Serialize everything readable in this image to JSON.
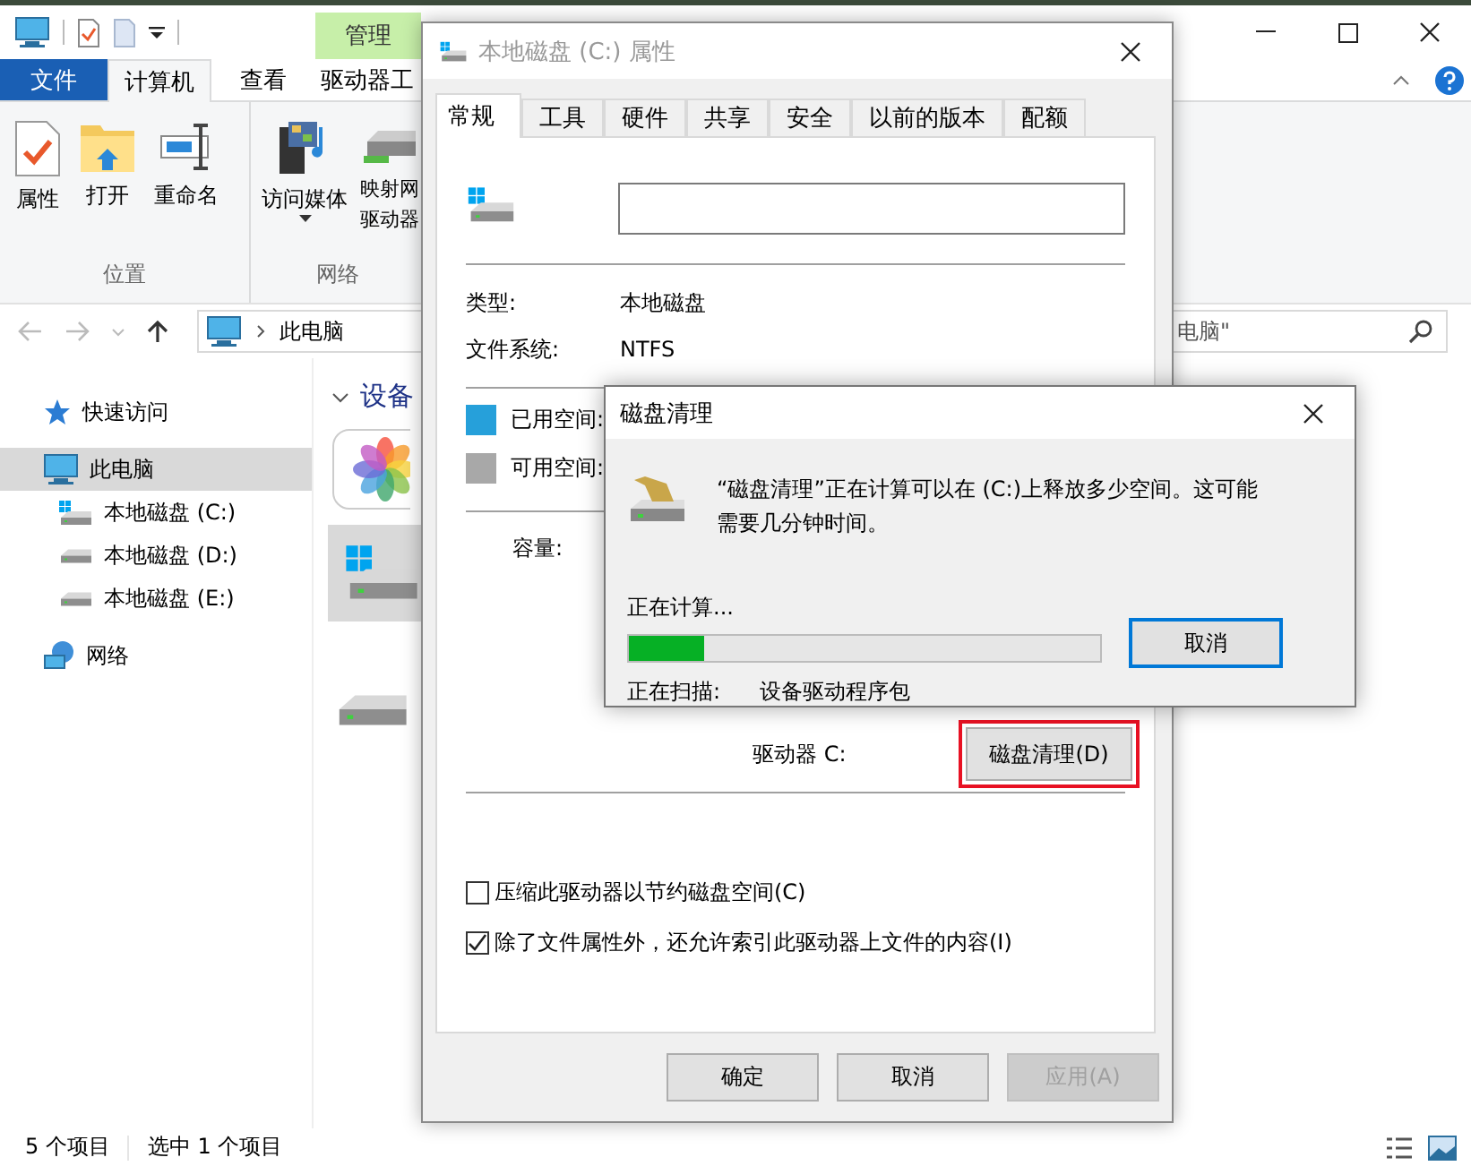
{
  "explorer": {
    "context_tab": "管理",
    "ribbon_tabs": [
      {
        "label": "文件",
        "kind": "file",
        "selected": false
      },
      {
        "label": "计算机",
        "kind": "tab",
        "selected": true
      },
      {
        "label": "查看",
        "kind": "tab",
        "selected": false
      },
      {
        "label": "驱动器工",
        "kind": "tab",
        "selected": false
      }
    ],
    "ribbon_groups": [
      {
        "label": "位置",
        "buttons": [
          {
            "lines": [
              "属性"
            ],
            "kind": "properties"
          },
          {
            "lines": [
              "打开"
            ],
            "kind": "open"
          },
          {
            "lines": [
              "重命名"
            ],
            "kind": "rename"
          }
        ]
      },
      {
        "label": "网络",
        "buttons": [
          {
            "lines": [
              "访问媒体"
            ],
            "kind": "media",
            "has_menu": true
          },
          {
            "lines": [
              "映射网",
              "驱动器"
            ],
            "kind": "map",
            "has_menu": false
          }
        ]
      }
    ],
    "address": {
      "path": "此电脑"
    },
    "search": {
      "placeholder": "电脑\""
    },
    "nav": [
      {
        "label": "快速访问",
        "kind": "star",
        "selected": false
      },
      {
        "label": "此电脑",
        "kind": "pc",
        "selected": true,
        "children": [
          {
            "label": "本地磁盘 (C:)",
            "kind": "system-drive",
            "selected": false
          },
          {
            "label": "本地磁盘 (D:)",
            "kind": "drive",
            "selected": false
          },
          {
            "label": "本地磁盘 (E:)",
            "kind": "drive",
            "selected": false
          }
        ]
      },
      {
        "label": "网络",
        "kind": "network",
        "selected": false
      }
    ],
    "section": {
      "label": "设备"
    },
    "items": [
      {
        "kind": "photos",
        "selected": false
      },
      {
        "kind": "system-drive",
        "selected": true
      },
      {
        "kind": "drive",
        "selected": false
      }
    ],
    "status_bar": {
      "count": "5 个项目",
      "selection": "选中 1 个项目"
    }
  },
  "properties": {
    "title": "本地磁盘 (C:) 属性",
    "tabs": [
      {
        "label": "常规",
        "selected": true
      },
      {
        "label": "工具",
        "selected": false
      },
      {
        "label": "硬件",
        "selected": false
      },
      {
        "label": "共享",
        "selected": false
      },
      {
        "label": "安全",
        "selected": false
      },
      {
        "label": "以前的版本",
        "selected": false
      },
      {
        "label": "配额",
        "selected": false
      }
    ],
    "info": [
      {
        "label": "类型:",
        "value": "本地磁盘"
      },
      {
        "label": "文件系统:",
        "value": "NTFS"
      }
    ],
    "space": [
      {
        "label": "已用空间:",
        "color": "#26a0da"
      },
      {
        "label": "可用空间:",
        "color": "#a8a8a8"
      }
    ],
    "capacity_label": "容量:",
    "drive_label": "驱动器 C:",
    "cleanup_button": {
      "label": "磁盘清理(D)",
      "highlighted": true
    },
    "options": [
      {
        "label": "压缩此驱动器以节约磁盘空间(C)",
        "checked": false
      },
      {
        "label": "除了文件属性外，还允许索引此驱动器上文件的内容(I)",
        "checked": true
      }
    ],
    "buttons": [
      {
        "label": "确定",
        "disabled": false
      },
      {
        "label": "取消",
        "disabled": false
      },
      {
        "label": "应用(A)",
        "disabled": true
      }
    ]
  },
  "cleanup": {
    "title": "磁盘清理",
    "message": "“磁盘清理”正在计算可以在 (C:)上释放多少空间。这可能需要几分钟时间。",
    "status": "正在计算...",
    "level": 0.16,
    "scan_label": "正在扫描:",
    "scan_item": "设备驱动程序包",
    "cancel": "取消"
  }
}
